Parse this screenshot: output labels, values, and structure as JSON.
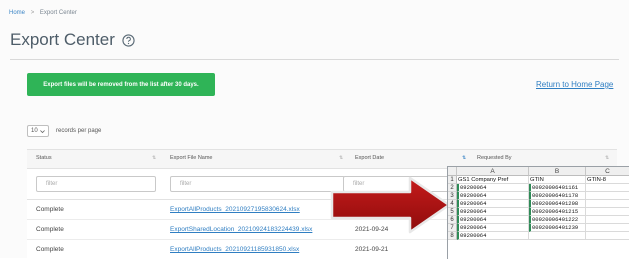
{
  "breadcrumb": {
    "home": "Home",
    "separator": ">",
    "current": "Export Center"
  },
  "page": {
    "title": "Export Center",
    "help_icon": "question-circle-icon"
  },
  "notice": {
    "text": "Export files will be removed from the list after 30 days."
  },
  "return_link": "Return to Home Page",
  "pagination": {
    "per_page_value": "10",
    "per_page_label": "records per page"
  },
  "table": {
    "headers": [
      "Status",
      "Export File Name",
      "Export Date",
      "Requested By"
    ],
    "filter_placeholder": "filter",
    "rows": [
      {
        "status": "Complete",
        "file": "ExportAllProducts_20210927195830624.xlsx",
        "date": ""
      },
      {
        "status": "Complete",
        "file": "ExportSharedLocation_20210924183224439.xlsx",
        "date": "2021-09-24"
      },
      {
        "status": "Complete",
        "file": "ExportAllProducts_20210921185931850.xlsx",
        "date": "2021-09-21"
      }
    ]
  },
  "spreadsheet": {
    "columns": [
      "A",
      "B",
      "C"
    ],
    "rows": [
      [
        "GS1 Company Pref",
        "GTIN",
        "GTIN-8"
      ],
      [
        "09200064",
        "00920006401161",
        ""
      ],
      [
        "09200064",
        "00920006401178",
        ""
      ],
      [
        "09200064",
        "00920006401208",
        ""
      ],
      [
        "09200064",
        "00920006401215",
        ""
      ],
      [
        "09200064",
        "00920006401222",
        ""
      ],
      [
        "09200064",
        "00920006401239",
        ""
      ],
      [
        "09200064",
        "",
        ""
      ]
    ]
  },
  "colors": {
    "accent": "#2fb457",
    "link": "#2f7ec2",
    "arrow": "#b81414"
  }
}
